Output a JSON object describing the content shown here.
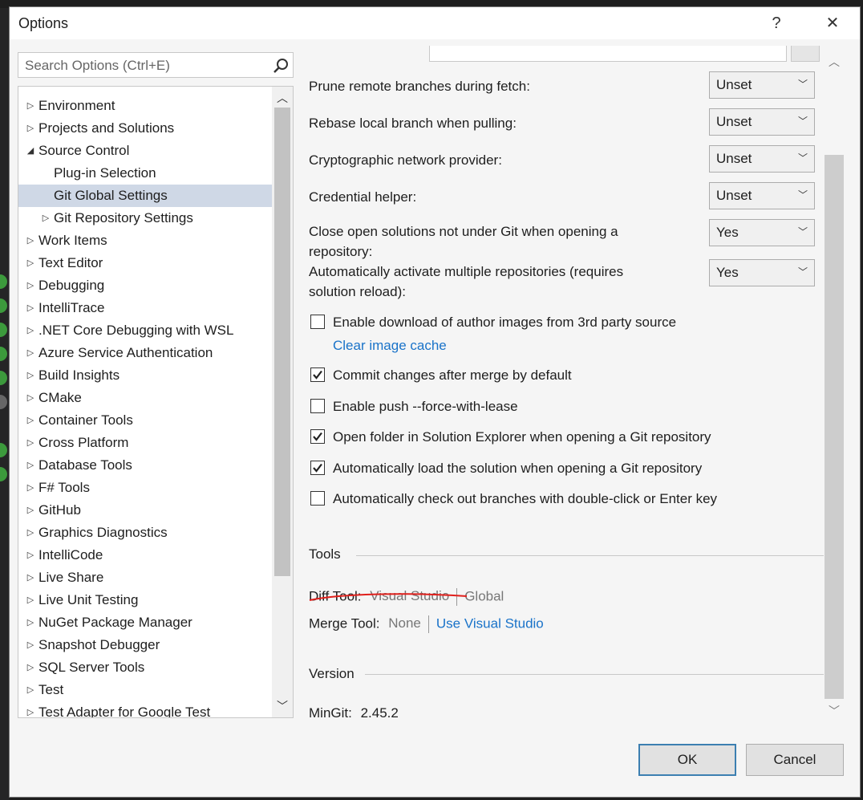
{
  "window": {
    "title": "Options",
    "help_label": "?",
    "close_label": "✕"
  },
  "search": {
    "placeholder": "Search Options (Ctrl+E)",
    "value": ""
  },
  "tree": {
    "items": [
      {
        "label": "Environment",
        "level": 0,
        "state": "collapsed",
        "selected": false
      },
      {
        "label": "Projects and Solutions",
        "level": 0,
        "state": "collapsed",
        "selected": false
      },
      {
        "label": "Source Control",
        "level": 0,
        "state": "expanded",
        "selected": false
      },
      {
        "label": "Plug-in Selection",
        "level": 1,
        "state": "leaf",
        "selected": false
      },
      {
        "label": "Git Global Settings",
        "level": 1,
        "state": "leaf",
        "selected": true
      },
      {
        "label": "Git Repository Settings",
        "level": 1,
        "state": "collapsed",
        "selected": false
      },
      {
        "label": "Work Items",
        "level": 0,
        "state": "collapsed",
        "selected": false
      },
      {
        "label": "Text Editor",
        "level": 0,
        "state": "collapsed",
        "selected": false
      },
      {
        "label": "Debugging",
        "level": 0,
        "state": "collapsed",
        "selected": false
      },
      {
        "label": "IntelliTrace",
        "level": 0,
        "state": "collapsed",
        "selected": false
      },
      {
        "label": ".NET Core Debugging with WSL",
        "level": 0,
        "state": "collapsed",
        "selected": false
      },
      {
        "label": "Azure Service Authentication",
        "level": 0,
        "state": "collapsed",
        "selected": false
      },
      {
        "label": "Build Insights",
        "level": 0,
        "state": "collapsed",
        "selected": false
      },
      {
        "label": "CMake",
        "level": 0,
        "state": "collapsed",
        "selected": false
      },
      {
        "label": "Container Tools",
        "level": 0,
        "state": "collapsed",
        "selected": false
      },
      {
        "label": "Cross Platform",
        "level": 0,
        "state": "collapsed",
        "selected": false
      },
      {
        "label": "Database Tools",
        "level": 0,
        "state": "collapsed",
        "selected": false
      },
      {
        "label": "F# Tools",
        "level": 0,
        "state": "collapsed",
        "selected": false
      },
      {
        "label": "GitHub",
        "level": 0,
        "state": "collapsed",
        "selected": false
      },
      {
        "label": "Graphics Diagnostics",
        "level": 0,
        "state": "collapsed",
        "selected": false
      },
      {
        "label": "IntelliCode",
        "level": 0,
        "state": "collapsed",
        "selected": false
      },
      {
        "label": "Live Share",
        "level": 0,
        "state": "collapsed",
        "selected": false
      },
      {
        "label": "Live Unit Testing",
        "level": 0,
        "state": "collapsed",
        "selected": false
      },
      {
        "label": "NuGet Package Manager",
        "level": 0,
        "state": "collapsed",
        "selected": false
      },
      {
        "label": "Snapshot Debugger",
        "level": 0,
        "state": "collapsed",
        "selected": false
      },
      {
        "label": "SQL Server Tools",
        "level": 0,
        "state": "collapsed",
        "selected": false
      },
      {
        "label": "Test",
        "level": 0,
        "state": "collapsed",
        "selected": false
      },
      {
        "label": "Test Adapter for Google Test",
        "level": 0,
        "state": "collapsed",
        "selected": false
      }
    ]
  },
  "settings": {
    "dropdowns": [
      {
        "label": "Prune remote branches during fetch:",
        "value": "Unset"
      },
      {
        "label": "Rebase local branch when pulling:",
        "value": "Unset"
      },
      {
        "label": "Cryptographic network provider:",
        "value": "Unset"
      },
      {
        "label": "Credential helper:",
        "value": "Unset"
      },
      {
        "label_line1": "Close open solutions not under Git when opening a",
        "label_line2": "repository:",
        "value": "Yes"
      },
      {
        "label_line1": "Automatically activate multiple repositories (requires",
        "label_line2": "solution reload):",
        "value": "Yes"
      }
    ],
    "checkboxes": [
      {
        "label": "Enable download of author images from 3rd party source",
        "checked": false
      },
      {
        "label": "Commit changes after merge by default",
        "checked": true
      },
      {
        "label": "Enable push --force-with-lease",
        "checked": false
      },
      {
        "label": "Open folder in Solution Explorer when opening a Git repository",
        "checked": true
      },
      {
        "label": "Automatically load the solution when opening a Git repository",
        "checked": true
      },
      {
        "label": "Automatically check out branches with double-click or Enter key",
        "checked": false
      }
    ],
    "clear_cache_link": "Clear image cache"
  },
  "tools": {
    "heading": "Tools",
    "diff_label": "Diff Tool:",
    "diff_current": "Visual Studio",
    "diff_option": "Global",
    "merge_label": "Merge Tool:",
    "merge_current": "None",
    "merge_option": "Use Visual Studio"
  },
  "version": {
    "heading": "Version",
    "mingit_label": "MinGit:",
    "mingit_value": "2.45.2"
  },
  "buttons": {
    "ok": "OK",
    "cancel": "Cancel"
  },
  "colors": {
    "accent_link": "#1a73c9",
    "selection": "#cfd8e6",
    "annotation": "#e0201c"
  },
  "icons": {
    "search": "search-icon",
    "scroll_up": "chevron-up-icon",
    "scroll_down": "chevron-down-icon"
  }
}
